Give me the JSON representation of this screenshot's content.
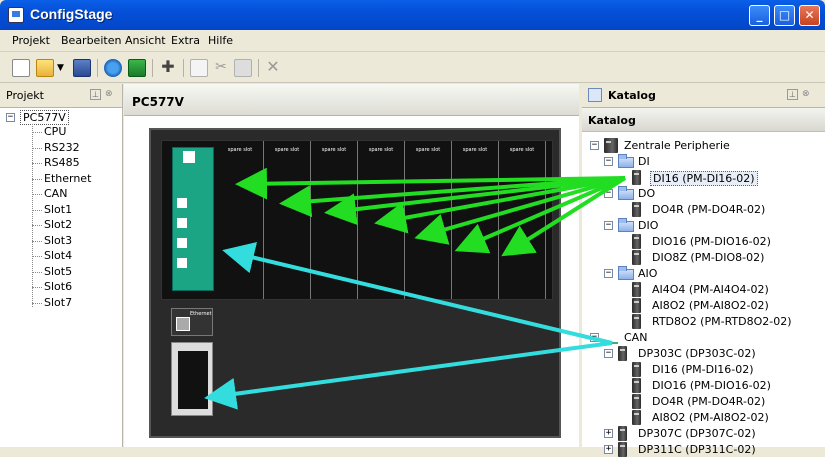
{
  "window": {
    "title": "ConfigStage"
  },
  "menu": [
    "Projekt",
    "Bearbeiten",
    "Ansicht",
    "Extra",
    "Hilfe"
  ],
  "toolbar_icons": [
    "new-file-icon",
    "open-folder-icon",
    "dropdown-arrow-icon",
    "save-icon",
    "refresh-icon",
    "download-icon",
    "add-icon",
    "copy-icon",
    "cut-icon",
    "paste-icon",
    "delete-icon"
  ],
  "project_panel": {
    "title": "Projekt",
    "root": "PC577V",
    "items": [
      "CPU",
      "RS232",
      "RS485",
      "Ethernet",
      "CAN",
      "Slot1",
      "Slot2",
      "Slot3",
      "Slot4",
      "Slot5",
      "Slot6",
      "Slot7"
    ]
  },
  "center": {
    "title": "PC577V"
  },
  "rack": {
    "slot_labels": [
      "spare slot",
      "spare slot",
      "spare slot",
      "spare slot",
      "spare slot",
      "spare slot",
      "spare slot"
    ],
    "cpu_label": "Ethernet"
  },
  "catalog": {
    "tab_title": "Katalog",
    "header": "Katalog",
    "nodes": [
      {
        "label": "Zentrale Peripherie"
      },
      {
        "label": "DI"
      },
      {
        "label": "DI16 (PM-DI16-02)",
        "selected": true
      },
      {
        "label": "DO"
      },
      {
        "label": "DO4R (PM-DO4R-02)"
      },
      {
        "label": "DIO"
      },
      {
        "label": "DIO16 (PM-DIO16-02)"
      },
      {
        "label": "DIO8Z (PM-DIO8-02)"
      },
      {
        "label": "AIO"
      },
      {
        "label": "AI4O4 (PM-AI4O4-02)"
      },
      {
        "label": "AI8O2 (PM-AI8O2-02)"
      },
      {
        "label": "RTD8O2 (PM-RTD8O2-02)"
      },
      {
        "label": "CAN"
      },
      {
        "label": "DP303C (DP303C-02)"
      },
      {
        "label": "DI16 (PM-DI16-02)"
      },
      {
        "label": "DIO16 (PM-DIO16-02)"
      },
      {
        "label": "DO4R (PM-DO4R-02)"
      },
      {
        "label": "AI8O2 (PM-AI8O2-02)"
      },
      {
        "label": "DP307C (DP307C-02)"
      },
      {
        "label": "DP311C (DP311C-02)"
      }
    ]
  },
  "colors": {
    "green_arrow": "#22dd22",
    "cyan_arrow": "#33dddd",
    "selection": "#316ac5"
  }
}
